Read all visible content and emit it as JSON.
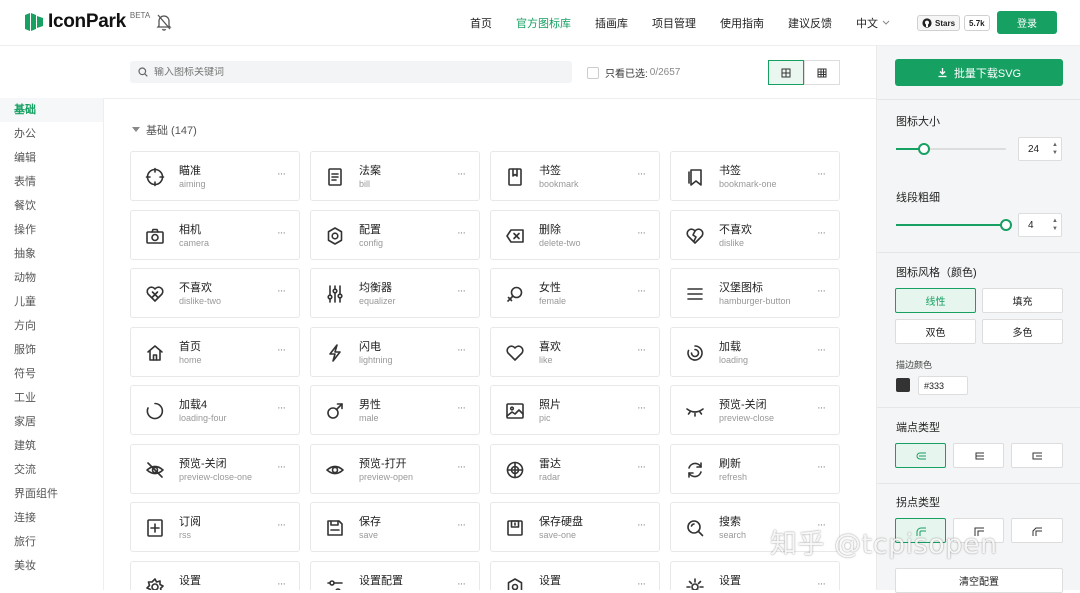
{
  "brand": {
    "name": "IconPark",
    "badge": "BETA"
  },
  "nav": [
    {
      "label": "首页",
      "active": false
    },
    {
      "label": "官方图标库",
      "active": true
    },
    {
      "label": "插画库",
      "active": false
    },
    {
      "label": "项目管理",
      "active": false
    },
    {
      "label": "使用指南",
      "active": false
    },
    {
      "label": "建议反馈",
      "active": false
    }
  ],
  "language": "中文",
  "github": {
    "label": "Stars",
    "count": "5.7k"
  },
  "login_label": "登录",
  "search": {
    "placeholder": "输入图标关键词"
  },
  "filter": {
    "label": "只看已选:",
    "count": "0/2657"
  },
  "group": {
    "title": "基础 (147)"
  },
  "sidebar": [
    "基础",
    "办公",
    "编辑",
    "表情",
    "餐饮",
    "操作",
    "抽象",
    "动物",
    "儿童",
    "方向",
    "服饰",
    "符号",
    "工业",
    "家居",
    "建筑",
    "交流",
    "界面组件",
    "连接",
    "旅行",
    "美妆"
  ],
  "icons": [
    {
      "name": "瞄准",
      "en": "aiming",
      "icon": "aiming-icon"
    },
    {
      "name": "法案",
      "en": "bill",
      "icon": "bill-icon"
    },
    {
      "name": "书签",
      "en": "bookmark",
      "icon": "bookmark-icon"
    },
    {
      "name": "书签",
      "en": "bookmark-one",
      "icon": "bookmark-one-icon"
    },
    {
      "name": "相机",
      "en": "camera",
      "icon": "camera-icon"
    },
    {
      "name": "配置",
      "en": "config",
      "icon": "config-icon"
    },
    {
      "name": "删除",
      "en": "delete-two",
      "icon": "delete-two-icon"
    },
    {
      "name": "不喜欢",
      "en": "dislike",
      "icon": "dislike-icon"
    },
    {
      "name": "不喜欢",
      "en": "dislike-two",
      "icon": "dislike-two-icon"
    },
    {
      "name": "均衡器",
      "en": "equalizer",
      "icon": "equalizer-icon"
    },
    {
      "name": "女性",
      "en": "female",
      "icon": "female-icon"
    },
    {
      "name": "汉堡图标",
      "en": "hamburger-button",
      "icon": "hamburger-button-icon"
    },
    {
      "name": "首页",
      "en": "home",
      "icon": "home-icon"
    },
    {
      "name": "闪电",
      "en": "lightning",
      "icon": "lightning-icon"
    },
    {
      "name": "喜欢",
      "en": "like",
      "icon": "like-icon"
    },
    {
      "name": "加载",
      "en": "loading",
      "icon": "loading-icon"
    },
    {
      "name": "加载4",
      "en": "loading-four",
      "icon": "loading-four-icon"
    },
    {
      "name": "男性",
      "en": "male",
      "icon": "male-icon"
    },
    {
      "name": "照片",
      "en": "pic",
      "icon": "pic-icon"
    },
    {
      "name": "预览-关闭",
      "en": "preview-close",
      "icon": "preview-close-icon"
    },
    {
      "name": "预览-关闭",
      "en": "preview-close-one",
      "icon": "preview-close-one-icon"
    },
    {
      "name": "预览-打开",
      "en": "preview-open",
      "icon": "preview-open-icon"
    },
    {
      "name": "雷达",
      "en": "radar",
      "icon": "radar-icon"
    },
    {
      "name": "刷新",
      "en": "refresh",
      "icon": "refresh-icon"
    },
    {
      "name": "订阅",
      "en": "rss",
      "icon": "rss-icon"
    },
    {
      "name": "保存",
      "en": "save",
      "icon": "save-icon"
    },
    {
      "name": "保存硬盘",
      "en": "save-one",
      "icon": "save-one-icon"
    },
    {
      "name": "搜索",
      "en": "search",
      "icon": "search-icon"
    },
    {
      "name": "设置",
      "en": "",
      "icon": "setting-icon"
    },
    {
      "name": "设置配置",
      "en": "",
      "icon": "setting-config-icon"
    },
    {
      "name": "设置",
      "en": "",
      "icon": "setting-two-icon"
    },
    {
      "name": "设置",
      "en": "",
      "icon": "setting-three-icon"
    }
  ],
  "more_label": "···",
  "panel": {
    "download_label": "批量下载SVG",
    "size": {
      "label": "图标大小",
      "value": "24",
      "level": 0.25
    },
    "stroke": {
      "label": "线段粗细",
      "value": "4",
      "level": 1.0
    },
    "style": {
      "label": "图标风格（颜色)",
      "options": [
        "线性",
        "填充",
        "双色",
        "多色"
      ],
      "selected": "线性"
    },
    "stroke_color": {
      "label": "描边颜色",
      "value": "#333"
    },
    "cap": {
      "label": "端点类型"
    },
    "join": {
      "label": "拐点类型"
    },
    "reset_label": "清空配置"
  },
  "watermark": "知乎 @tcpisopen",
  "colors": {
    "accent": "#16a062",
    "text": "#333333"
  }
}
